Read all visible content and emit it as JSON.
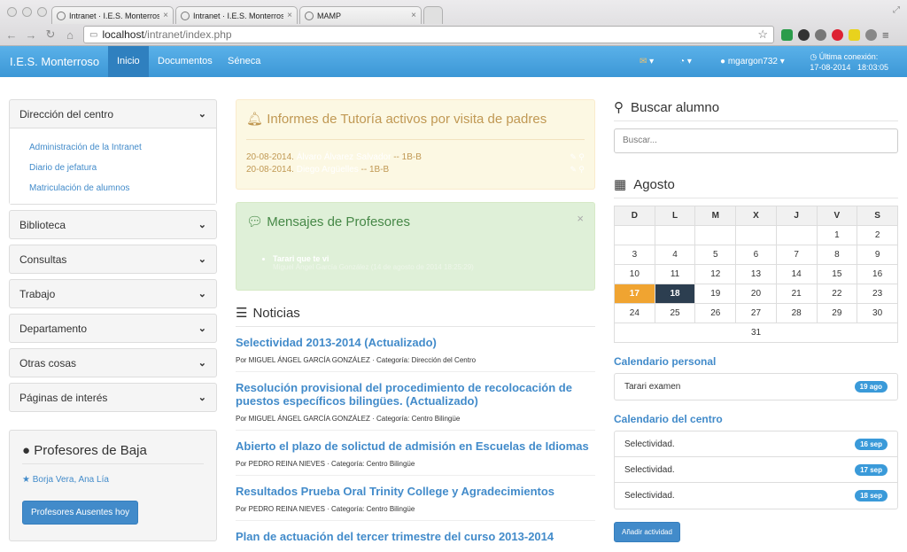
{
  "browser": {
    "tabs": [
      {
        "title": "Intranet · I.E.S. Monterroso"
      },
      {
        "title": "Intranet · I.E.S. Monterroso"
      },
      {
        "title": "MAMP"
      }
    ],
    "url_host": "localhost",
    "url_path": "/intranet/index.php"
  },
  "navbar": {
    "brand": "I.E.S. Monterroso",
    "items": [
      "Inicio",
      "Documentos",
      "Séneca"
    ],
    "user": "mgargon732",
    "last_connection_label": "Última conexión:",
    "last_connection_date": "17-08-2014",
    "last_connection_time": "18:03:05"
  },
  "sidebar": {
    "direccion": {
      "title": "Dirección del centro",
      "links": [
        "Administración de la Intranet",
        "Diario de jefatura",
        "Matriculación de alumnos"
      ]
    },
    "sections": [
      "Biblioteca",
      "Consultas",
      "Trabajo",
      "Departamento",
      "Otras cosas",
      "Páginas de interés"
    ],
    "baja": {
      "title": "Profesores de Baja",
      "names": "Borja Vera, Ana Lía",
      "button": "Profesores Ausentes hoy"
    }
  },
  "tutoria": {
    "title": "Informes de Tutoría activos por visita de padres",
    "rows": [
      {
        "date": "20-08-2014.",
        "name": "Álvaro Álvarez Salvador",
        "group": "-- 1B-B"
      },
      {
        "date": "20-08-2014.",
        "name": "Diego Argüelles",
        "group": "-- 1B-B"
      }
    ]
  },
  "mensajes": {
    "title": "Mensajes de Profesores",
    "item": "Tarari que te vi",
    "sub": "Miguel Ángel García González (14 de agosto de 2014 18:25:29)"
  },
  "noticias": {
    "title": "Noticias",
    "items": [
      {
        "title": "Selectividad 2013-2014 (Actualizado)",
        "meta": "Por MIGUEL ÁNGEL GARCÍA GONZÁLEZ · Categoría: Dirección del Centro"
      },
      {
        "title": "Resolución provisional del procedimiento de recolocación de puestos específicos bilingües. (Actualizado)",
        "meta": "Por MIGUEL ÁNGEL GARCÍA GONZÁLEZ · Categoría: Centro Bilingüe"
      },
      {
        "title": "Abierto el plazo de solictud de admisión en Escuelas de Idiomas",
        "meta": "Por PEDRO REINA NIEVES · Categoría: Centro Bilingüe"
      },
      {
        "title": "Resultados Prueba Oral Trinity College y Agradecimientos",
        "meta": "Por PEDRO REINA NIEVES · Categoría: Centro Bilingüe"
      },
      {
        "title": "Plan de actuación del tercer trimestre del curso 2013-2014",
        "meta": ""
      }
    ]
  },
  "buscar": {
    "title": "Buscar alumno",
    "placeholder": "Buscar..."
  },
  "calendar": {
    "month": "Agosto",
    "days": [
      "D",
      "L",
      "M",
      "X",
      "J",
      "V",
      "S"
    ],
    "weeks": [
      [
        "",
        "",
        "",
        "",
        "",
        "1",
        "2"
      ],
      [
        "3",
        "4",
        "5",
        "6",
        "7",
        "8",
        "9"
      ],
      [
        "10",
        "11",
        "12",
        "13",
        "14",
        "15",
        "16"
      ],
      [
        "17",
        "18",
        "19",
        "20",
        "21",
        "22",
        "23"
      ],
      [
        "24",
        "25",
        "26",
        "27",
        "28",
        "29",
        "30"
      ],
      [
        "31"
      ]
    ],
    "today": "17",
    "selected": "18"
  },
  "personal": {
    "title": "Calendario personal",
    "events": [
      {
        "name": "Tarari examen",
        "badge": "19 ago"
      }
    ]
  },
  "centro": {
    "title": "Calendario del centro",
    "events": [
      {
        "name": "Selectividad.",
        "badge": "16 sep"
      },
      {
        "name": "Selectividad.",
        "badge": "17 sep"
      },
      {
        "name": "Selectividad.",
        "badge": "18 sep"
      }
    ],
    "button": "Añadir actividad"
  },
  "colors": {
    "primary": "#428bca",
    "navbar": "#3c97d6",
    "today": "#f0a431",
    "selected": "#2c3e50"
  }
}
